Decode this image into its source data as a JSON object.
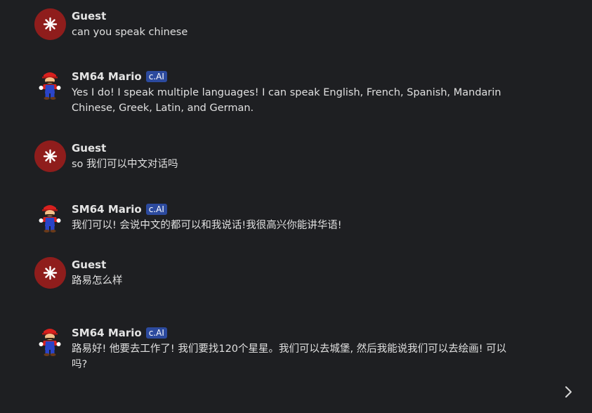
{
  "messages": [
    {
      "author": "Guest",
      "badge": "",
      "text": "can you speak chinese"
    },
    {
      "author": "SM64 Mario",
      "badge": "c.AI",
      "text": "Yes I do! I speak multiple languages! I can speak English, French, Spanish, Mandarin Chinese, Greek, Latin, and German."
    },
    {
      "author": "Guest",
      "badge": "",
      "text": "so 我们可以中文对话吗"
    },
    {
      "author": "SM64 Mario",
      "badge": "c.AI",
      "text": "我们可以! 会说中文的都可以和我说话!我很高兴你能讲华语!"
    },
    {
      "author": "Guest",
      "badge": "",
      "text": "路易怎么样"
    },
    {
      "author": "SM64 Mario",
      "badge": "c.AI",
      "text": "路易好! 他要去工作了! 我们要找120个星星。我们可以去城堡, 然后我能说我们可以去绘画! 可以吗?"
    }
  ],
  "icons": {
    "guest_avatar": "guest-asterisk-icon",
    "mario_avatar": "mario-avatar-icon",
    "next": "chevron-right-icon"
  },
  "colors": {
    "background": "#1e1f22",
    "guest_avatar": "#8f1d1c",
    "badge": "#2c4a9e"
  }
}
